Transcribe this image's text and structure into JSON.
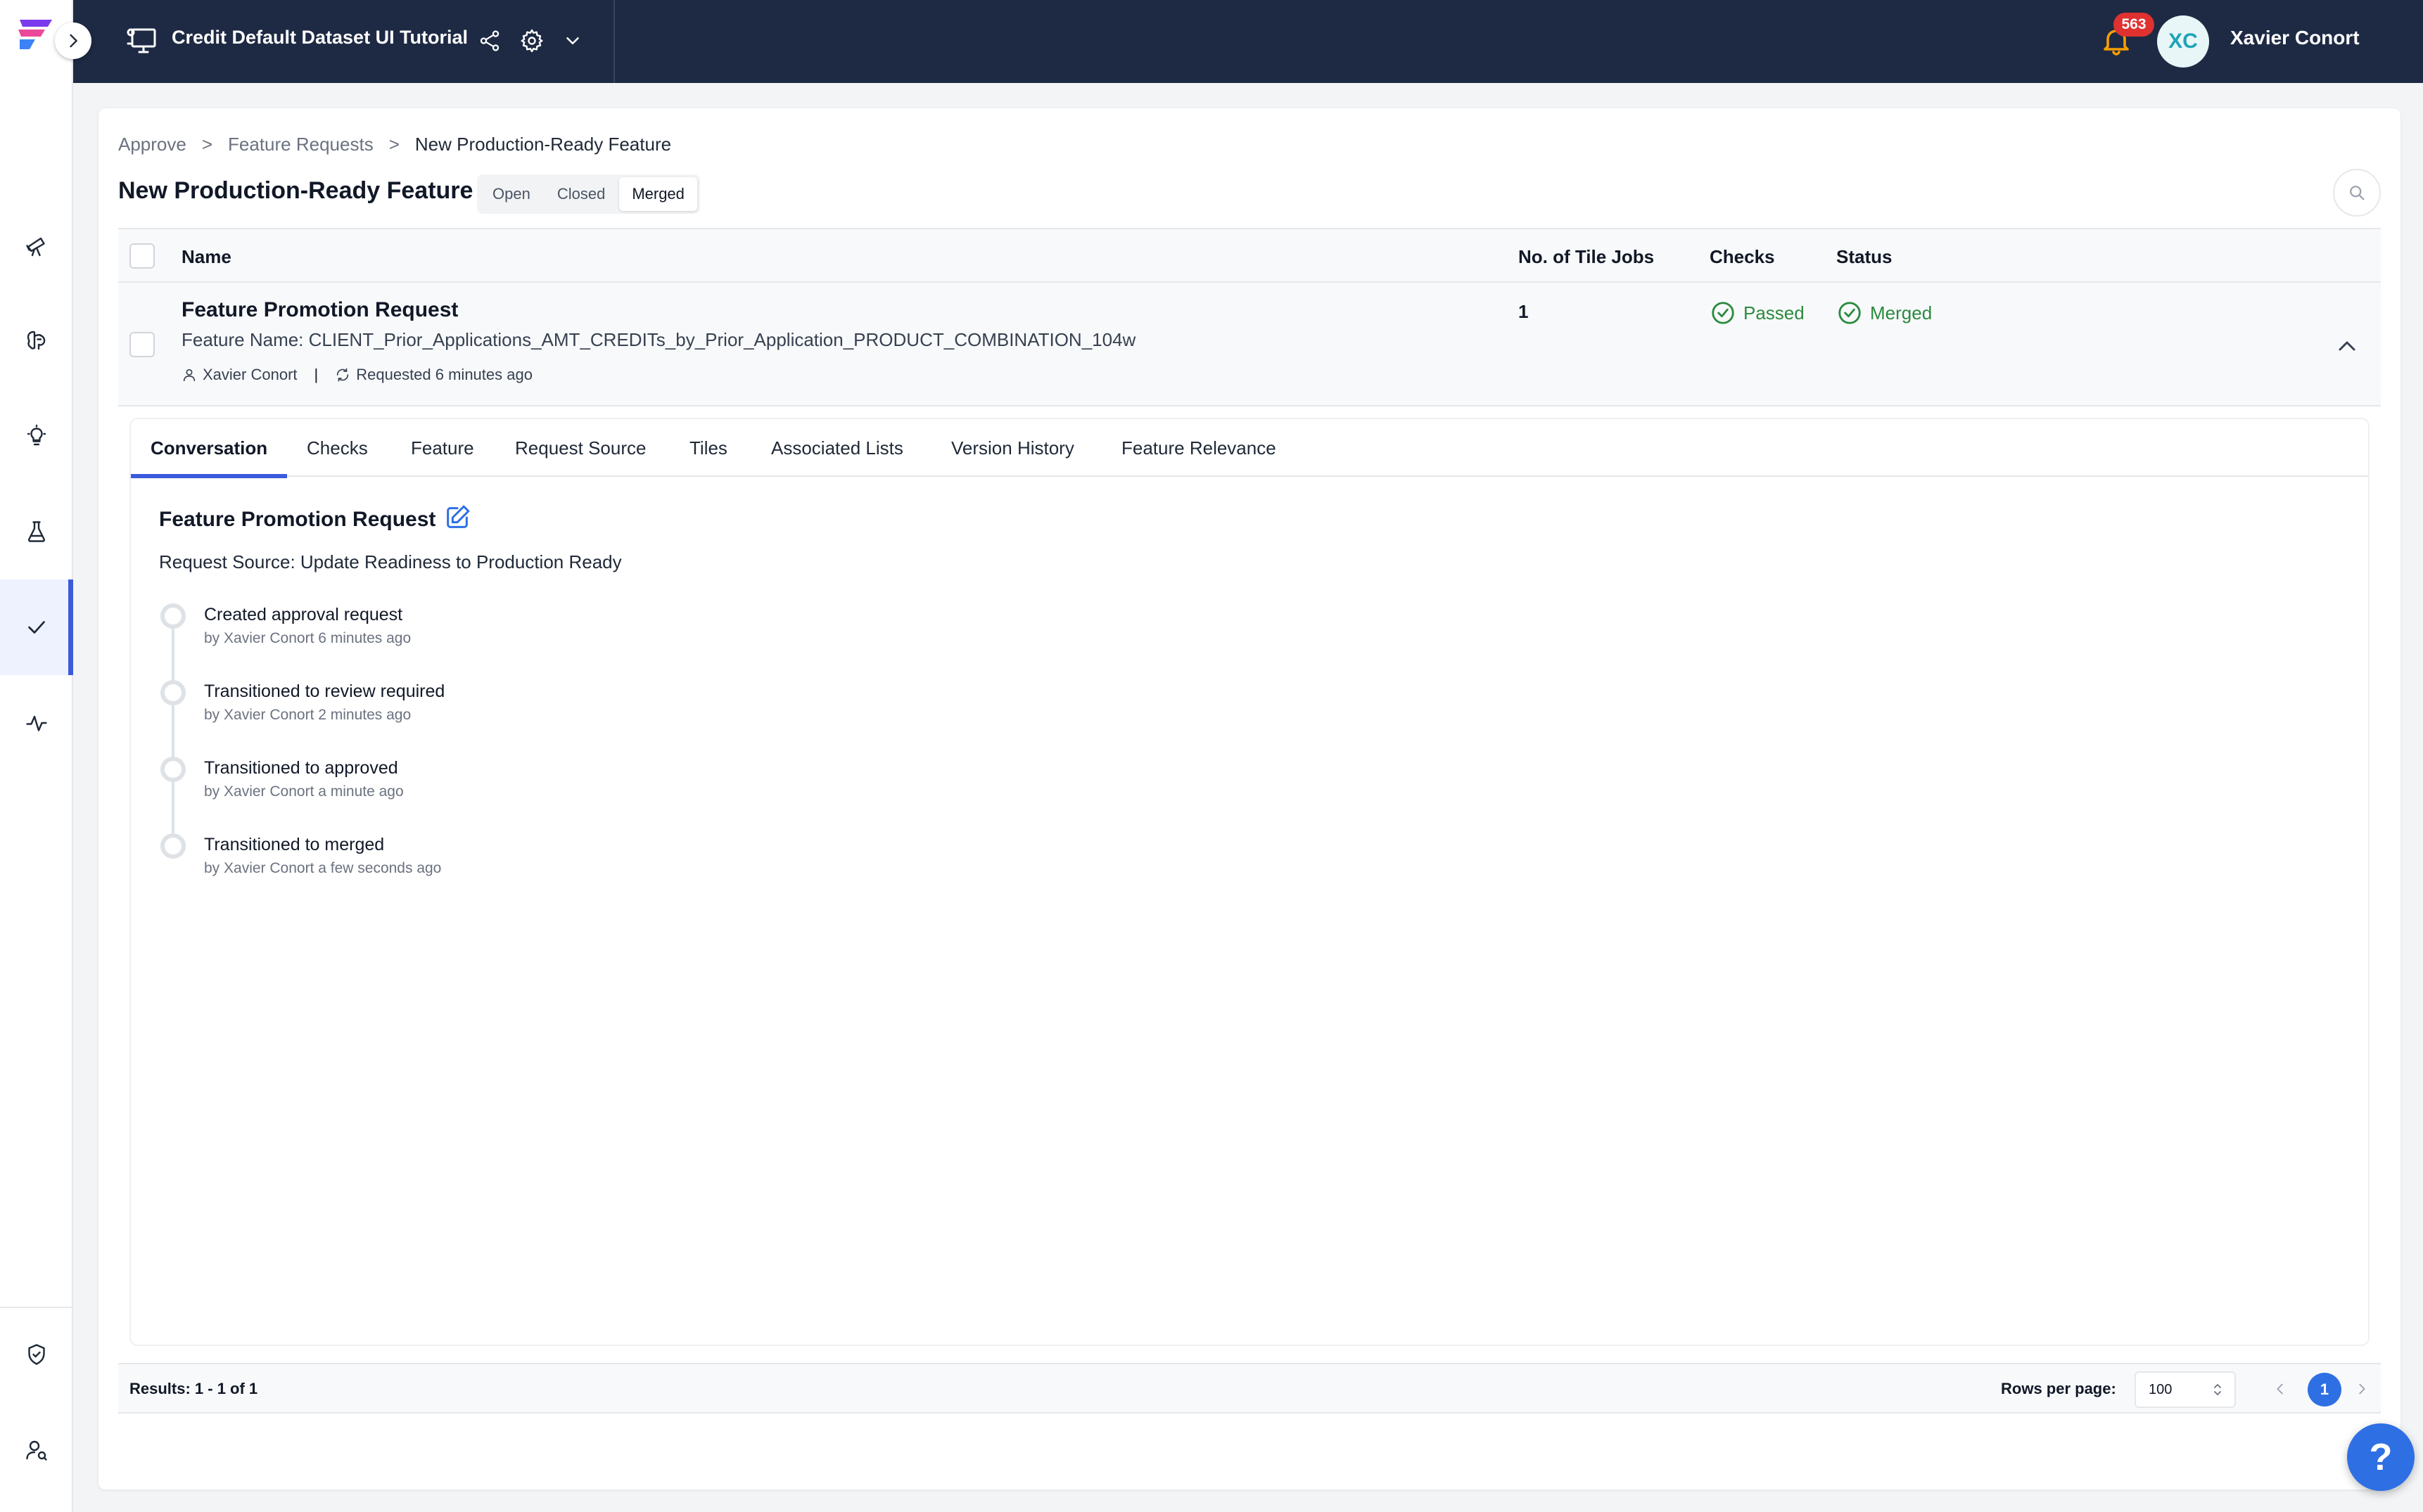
{
  "header": {
    "catalog_title": "Credit Default Dataset UI Tutorial",
    "notification_count": "563",
    "user_initials": "XC",
    "user_name": "Xavier Conort"
  },
  "sidebar": {
    "items": [
      {
        "icon": "telescope-icon"
      },
      {
        "icon": "brain-icon"
      },
      {
        "icon": "lightbulb-icon"
      },
      {
        "icon": "flask-icon"
      },
      {
        "icon": "check-icon",
        "active": true
      },
      {
        "icon": "activity-icon"
      },
      {
        "icon": "shield-icon"
      },
      {
        "icon": "user-search-icon"
      }
    ]
  },
  "breadcrumb": [
    "Approve",
    ">",
    "Feature Requests",
    ">",
    "New Production-Ready Feature"
  ],
  "page_title": "New Production-Ready Feature",
  "filters": {
    "open": "Open",
    "closed": "Closed",
    "merged": "Merged",
    "selected": "Merged"
  },
  "table": {
    "columns": {
      "name": "Name",
      "jobs": "No. of Tile Jobs",
      "checks": "Checks",
      "status": "Status"
    },
    "row": {
      "title": "Feature Promotion Request",
      "feature_name": "Feature Name: CLIENT_Prior_Applications_AMT_CREDITs_by_Prior_Application_PRODUCT_COMBINATION_104w",
      "requester": "Xavier Conort",
      "requested": "Requested 6 minutes ago",
      "jobs": "1",
      "checks": "Passed",
      "status": "Merged"
    }
  },
  "detail": {
    "tabs": [
      "Conversation",
      "Checks",
      "Feature",
      "Request Source",
      "Tiles",
      "Associated Lists",
      "Version History",
      "Feature Relevance"
    ],
    "active_tab": "Conversation",
    "section_title": "Feature Promotion Request",
    "request_source": "Request Source: Update Readiness to Production Ready",
    "timeline": [
      {
        "title": "Created approval request",
        "sub": "by Xavier Conort 6 minutes ago"
      },
      {
        "title": "Transitioned to review required",
        "sub": "by Xavier Conort 2 minutes ago"
      },
      {
        "title": "Transitioned to approved",
        "sub": "by Xavier Conort a minute ago"
      },
      {
        "title": "Transitioned to merged",
        "sub": "by Xavier Conort a few seconds ago"
      }
    ]
  },
  "footer": {
    "results": "Results: 1 - 1 of 1",
    "rows_per_page_label": "Rows per page:",
    "rows_per_page": "100",
    "page": "1"
  },
  "help_label": "?",
  "colors": {
    "accent": "#3b5bdb",
    "success": "#2b8a3e",
    "header_bg": "#1e2a44",
    "badge": "#e03131"
  }
}
